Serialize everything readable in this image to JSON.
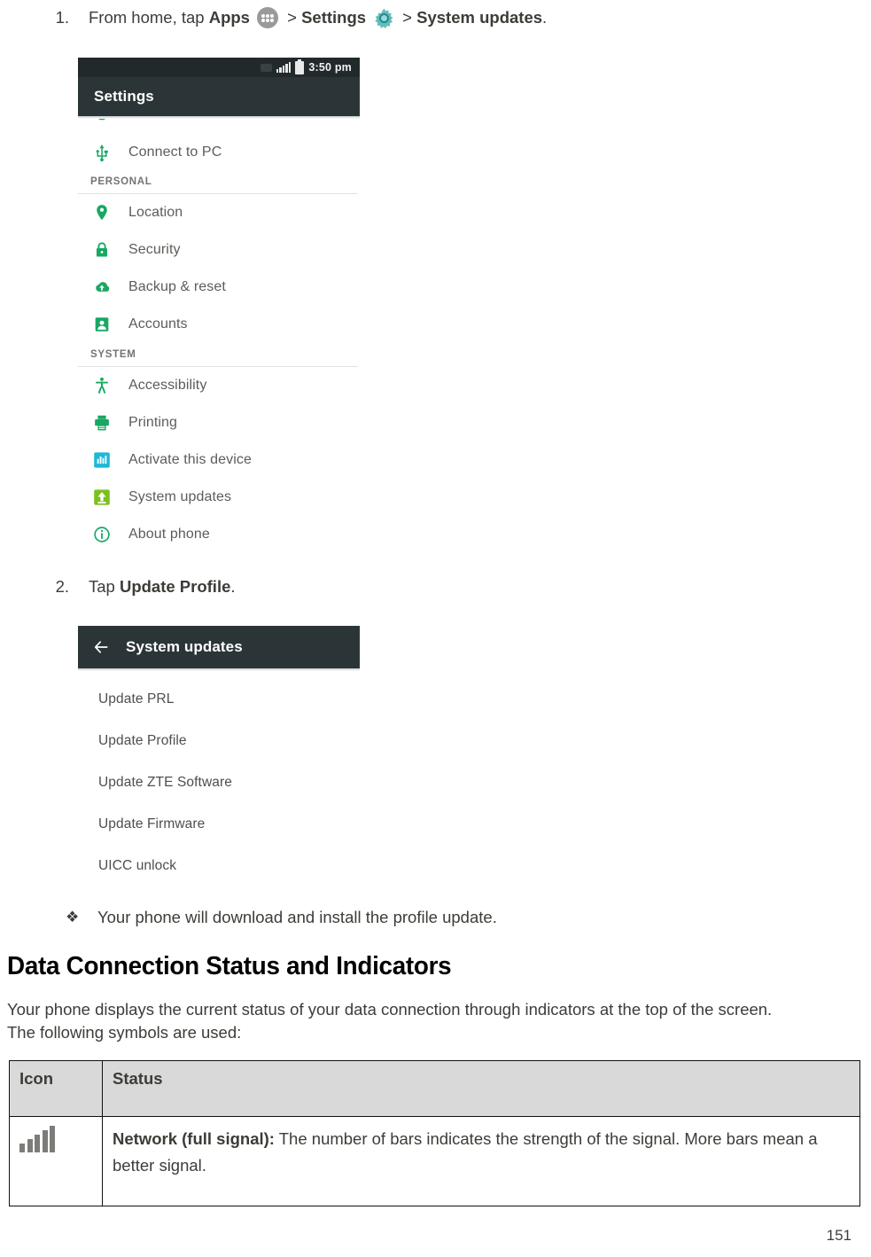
{
  "steps": [
    {
      "number": "1.",
      "pre": "From home, tap ",
      "bold1": "Apps",
      "apps_icon": "apps-grid-icon",
      "sep1": " > ",
      "bold2": "Settings",
      "gear_icon": "gear-icon",
      "sep2": " > ",
      "bold3": "System updates",
      "post": "."
    },
    {
      "number": "2.",
      "pre": "Tap ",
      "bold1": "Update Profile",
      "post": "."
    }
  ],
  "screenshot_settings": {
    "status_bar": {
      "signal_icon": "signal-bars-icon",
      "battery_icon": "battery-icon",
      "time": "3:50 pm"
    },
    "app_bar_title": "Settings",
    "top_partial_row": "Connect to PC",
    "rows_top": [
      {
        "label": "Connect to PC",
        "icon": "usb-icon",
        "color": "#1faa59"
      }
    ],
    "section_personal": "PERSONAL",
    "rows_personal": [
      {
        "label": "Location",
        "icon": "location-pin-icon",
        "color": "#18a862"
      },
      {
        "label": "Security",
        "icon": "lock-icon",
        "color": "#18a862"
      },
      {
        "label": "Backup & reset",
        "icon": "cloud-upload-icon",
        "color": "#18a862"
      },
      {
        "label": "Accounts",
        "icon": "person-card-icon",
        "color": "#18a862"
      }
    ],
    "section_system": "SYSTEM",
    "rows_system": [
      {
        "label": "Accessibility",
        "icon": "accessibility-person-icon",
        "color": "#18a862"
      },
      {
        "label": "Printing",
        "icon": "printer-icon",
        "color": "#18a862"
      },
      {
        "label": "Activate this device",
        "icon": "activate-device-icon",
        "color": "#1eb7d8"
      },
      {
        "label": "System updates",
        "icon": "system-update-arrow-icon",
        "color": "#7cc01f"
      },
      {
        "label": "About phone",
        "icon": "info-circle-icon",
        "color": "#18a862"
      }
    ]
  },
  "screenshot_updates": {
    "back_icon": "back-arrow-icon",
    "app_bar_title": "System updates",
    "rows": [
      {
        "label": "Update PRL"
      },
      {
        "label": "Update Profile"
      },
      {
        "label": "Update ZTE Software"
      },
      {
        "label": "Update Firmware"
      },
      {
        "label": "UICC unlock"
      }
    ]
  },
  "note": {
    "bullet": "❖",
    "text": "Your phone will download and install the profile update."
  },
  "heading": "Data Connection Status and Indicators",
  "paragraph_line1": "Your phone displays the current status of your data connection through indicators at the top of the screen.",
  "paragraph_line2": "The following symbols are used:",
  "table": {
    "headers": [
      "Icon",
      "Status"
    ],
    "rows": [
      {
        "icon": "signal-bars-full-icon",
        "status_bold": "Network (full signal):",
        "status_text": " The number of bars indicates the strength of the signal. More bars mean a better signal."
      }
    ]
  },
  "page_number": "151",
  "colors": {
    "appbar": "#2b3538",
    "statusbar": "#22292b",
    "table_header_bg": "#d9d9d9",
    "green": "#18a862",
    "cyan": "#1eb7d8",
    "lime": "#7cc01f"
  }
}
